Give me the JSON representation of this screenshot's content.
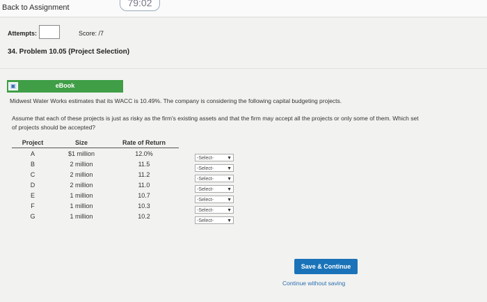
{
  "header": {
    "back_link": "Back to Assignment",
    "timer": "79:02"
  },
  "attempts_label": "Attempts:",
  "score_label": "Score: /7",
  "problem_title": "34. Problem 10.05 (Project Selection)",
  "ebook_label": "eBook",
  "intro_text": "Midwest Water Works estimates that its WACC is 10.49%. The company is considering the following capital budgeting projects.",
  "question_line1": "Assume that each of these projects is just as risky as the firm's existing assets and that the firm may accept all the projects or only some of them. Which set",
  "question_line2": "of projects should be accepted?",
  "table": {
    "headers": [
      "Project",
      "Size",
      "Rate of Return"
    ],
    "rows": [
      {
        "project": "A",
        "size": "$1 million",
        "rate": "12.0%"
      },
      {
        "project": "B",
        "size": "2 million",
        "rate": "11.5"
      },
      {
        "project": "C",
        "size": "2 million",
        "rate": "11.2"
      },
      {
        "project": "D",
        "size": "2 million",
        "rate": "11.0"
      },
      {
        "project": "E",
        "size": "1 million",
        "rate": "10.7"
      },
      {
        "project": "F",
        "size": "1 million",
        "rate": "10.3"
      },
      {
        "project": "G",
        "size": "1 million",
        "rate": "10.2"
      }
    ]
  },
  "select_value": "-Select-",
  "save_button": "Save & Continue",
  "continue_link": "Continue without saving"
}
